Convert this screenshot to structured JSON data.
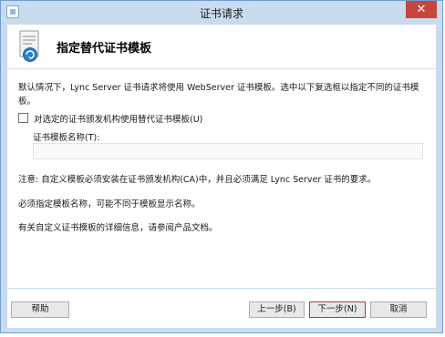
{
  "window": {
    "title": "证书请求",
    "close_glyph": "✕"
  },
  "header": {
    "title": "指定替代证书模板",
    "icon": "certificate-icon"
  },
  "content": {
    "description": "默认情况下，Lync Server 证书请求将使用 WebServer 证书模板。选中以下复选框以指定不同的证书模板。",
    "checkbox": {
      "label": "对选定的证书颁发机构使用替代证书模板(U)",
      "checked": false
    },
    "template_name": {
      "label": "证书模板名称(T):",
      "value": ""
    },
    "notes": [
      "注意: 自定义模板必须安装在证书颁发机构(CA)中，并且必须满足 Lync Server 证书的要求。",
      "必须指定模板名称，可能不同于模板显示名称。",
      "有关自定义证书模板的详细信息，请参阅产品文档。"
    ]
  },
  "buttons": {
    "help": "帮助",
    "back": "上一步(B)",
    "next": "下一步(N)",
    "cancel": "取消"
  },
  "colors": {
    "titlebar": "#c9dcef",
    "close_button": "#c7463a",
    "next_button_border": "#b23a3a"
  }
}
